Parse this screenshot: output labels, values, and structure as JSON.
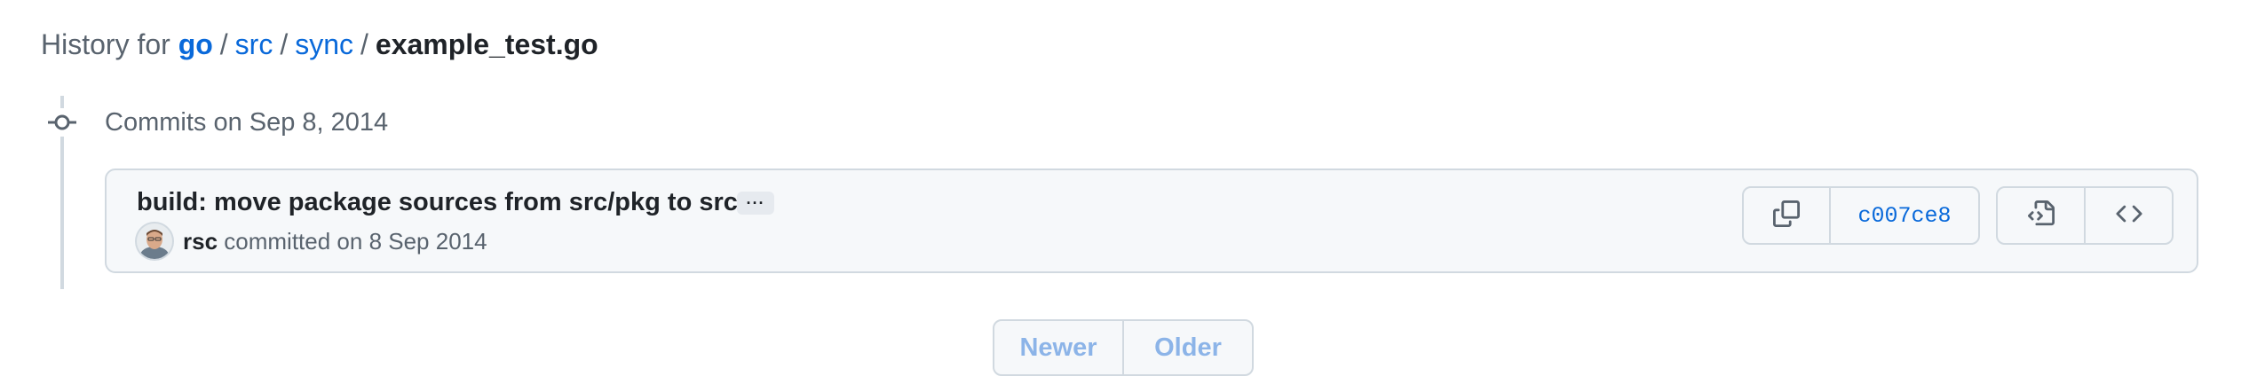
{
  "header": {
    "label": "History for",
    "path": [
      "go",
      "src",
      "sync"
    ],
    "separator": "/",
    "file": "example_test.go"
  },
  "timeline": {
    "day_label": "Commits on Sep 8, 2014"
  },
  "commit": {
    "title": "build: move package sources from src/pkg to src",
    "ellipsis_label": "···",
    "author": "rsc",
    "action": "committed on 8 Sep 2014",
    "sha": "c007ce8"
  },
  "icons": {
    "node": "git-commit-icon",
    "copy": "copy-icon",
    "browse": "file-code-icon",
    "code": "code-icon",
    "avatar": "avatar-image"
  },
  "pagination": {
    "newer": "Newer",
    "older": "Older"
  },
  "colors": {
    "link": "#0969da",
    "muted": "#59636e",
    "border": "#d1d9e0",
    "disabled_link": "#8cb4e8"
  }
}
